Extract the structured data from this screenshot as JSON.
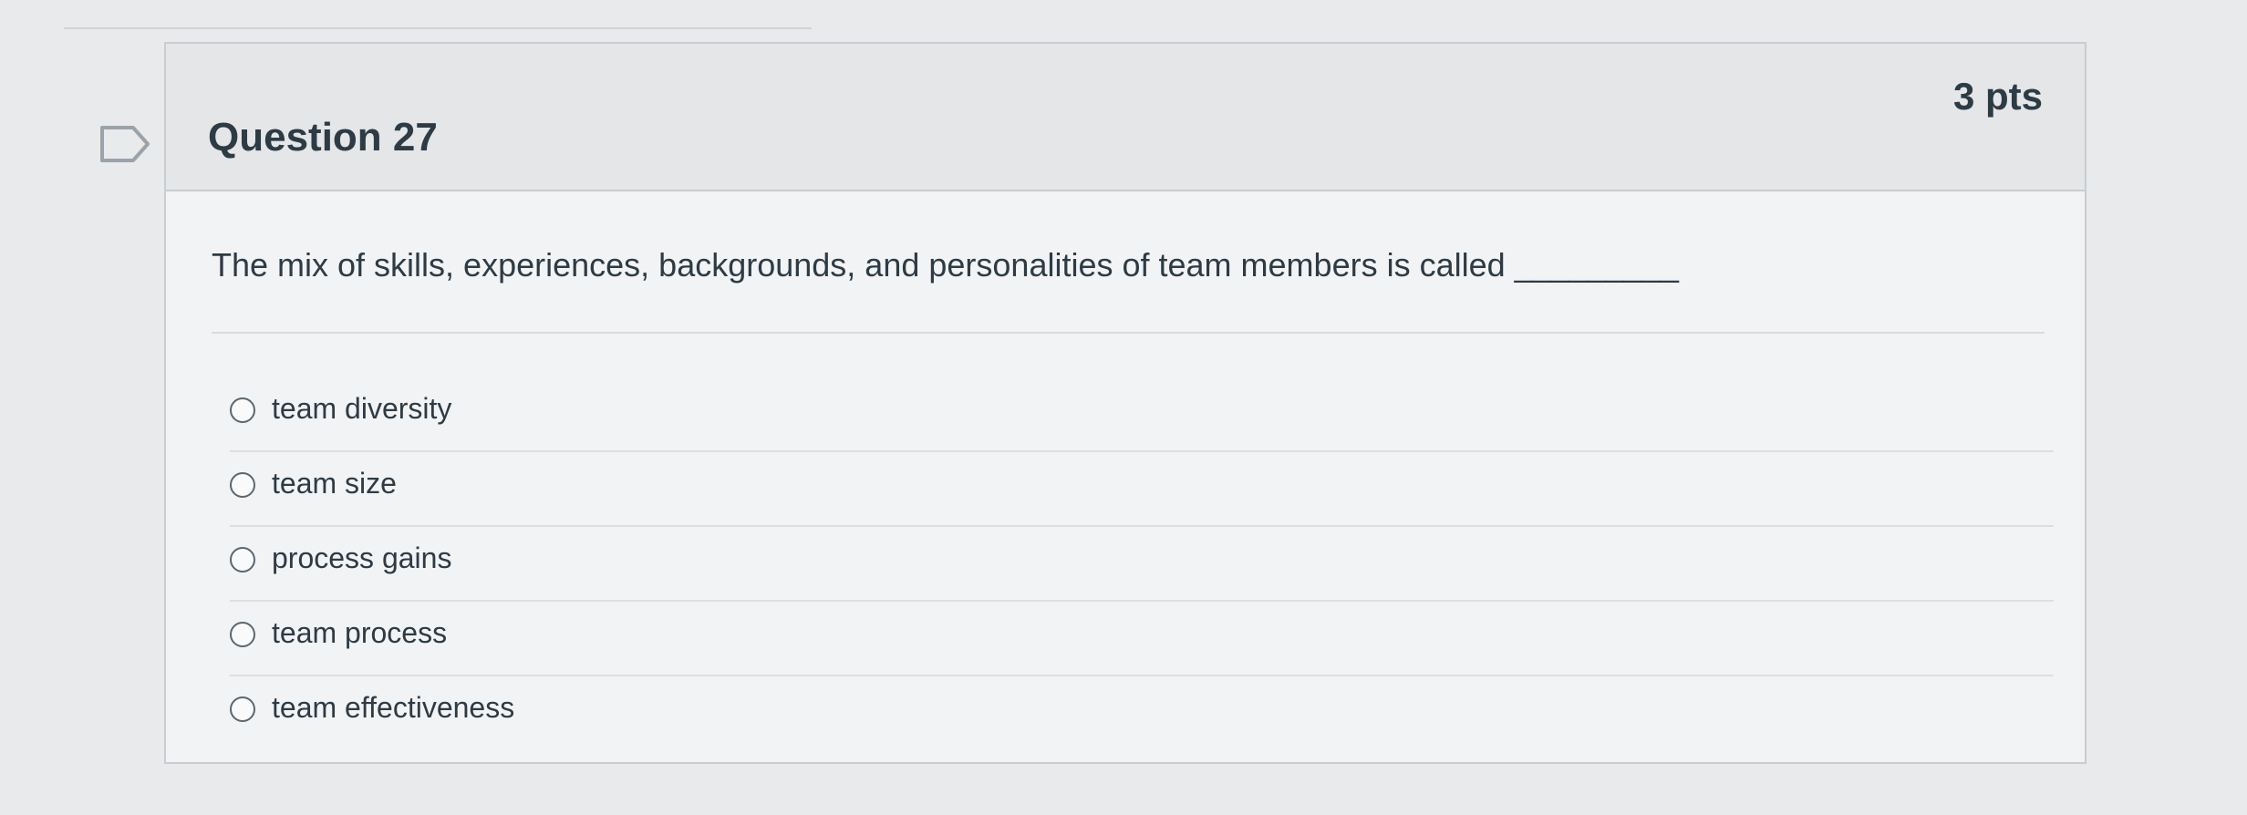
{
  "question": {
    "title": "Question 27",
    "points": "3 pts",
    "text": "The mix of skills, experiences, backgrounds, and personalities of team members is called _________",
    "flag_icon": "bookmark-flag-icon"
  },
  "answers": [
    {
      "label": "team diversity"
    },
    {
      "label": "team size"
    },
    {
      "label": "process gains"
    },
    {
      "label": "team process"
    },
    {
      "label": "team effectiveness"
    }
  ],
  "colors": {
    "background": "#e9eaec",
    "header": "#e4e6e8",
    "text": "#2d3b45",
    "border": "#c7cdd1"
  }
}
